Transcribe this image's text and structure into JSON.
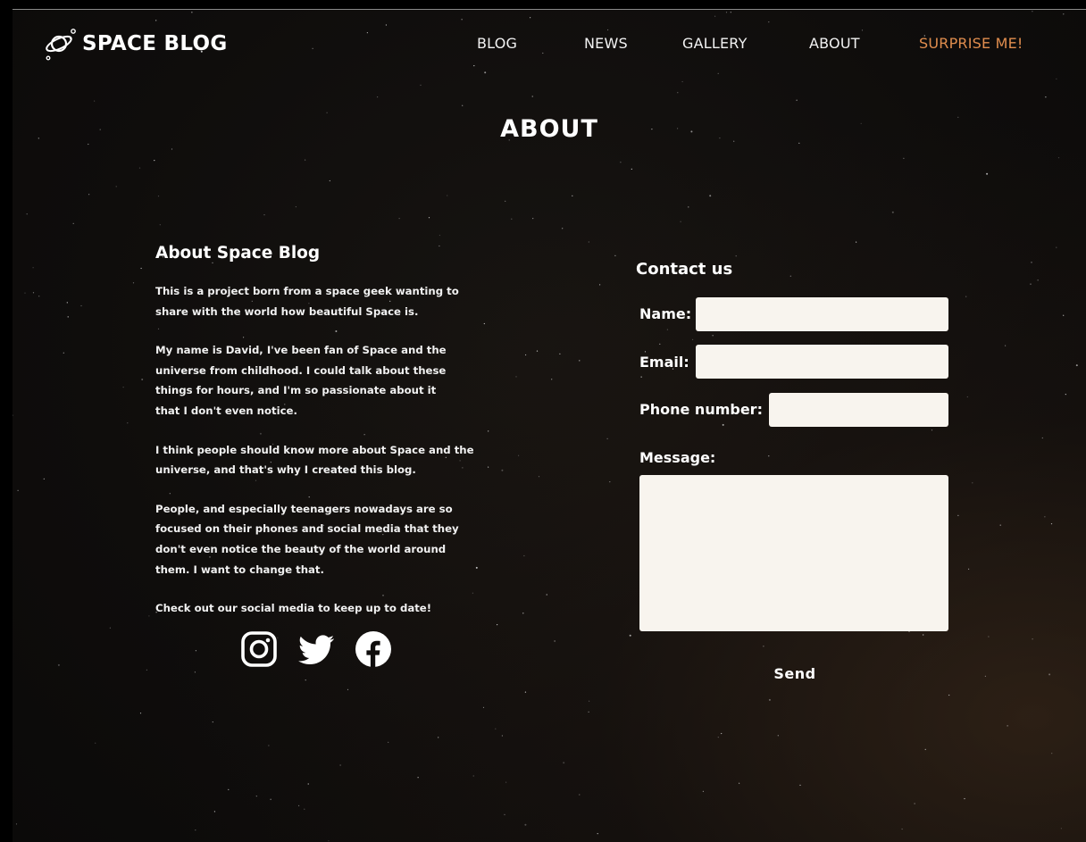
{
  "header": {
    "logo_text": "SPACE BLOG",
    "nav": [
      {
        "label": "BLOG"
      },
      {
        "label": "NEWS"
      },
      {
        "label": "GALLERY"
      },
      {
        "label": "ABOUT"
      },
      {
        "label": "SURPRISE ME!"
      }
    ]
  },
  "page": {
    "title": "ABOUT"
  },
  "about": {
    "heading": "About Space Blog",
    "paragraphs": [
      "This is a project born from a space geek wanting to share with the world how beautiful Space is.",
      "My name is David, I've been fan of Space and the universe from childhood. I could talk about these things for hours, and I'm so passionate about it that I don't even notice.",
      "I think people should know more about Space and the universe, and that's why I created this blog.",
      "People, and especially teenagers nowadays are so focused on their phones and social media that they don't even notice the beauty of the world around them. I want to change that.",
      "Check out our social media to keep up to date!"
    ],
    "socials": [
      "instagram-icon",
      "twitter-icon",
      "facebook-icon"
    ]
  },
  "contact": {
    "heading": "Contact us",
    "name_label": "Name:",
    "email_label": "Email:",
    "phone_label": "Phone number:",
    "message_label": "Message:",
    "name_value": "",
    "email_value": "",
    "phone_value": "",
    "message_value": "",
    "send_label": "Send"
  },
  "colors": {
    "accent": "#e08d4e",
    "background": "#0f0d0c",
    "input_bg": "#f8f4ee",
    "text": "#ffffff"
  }
}
